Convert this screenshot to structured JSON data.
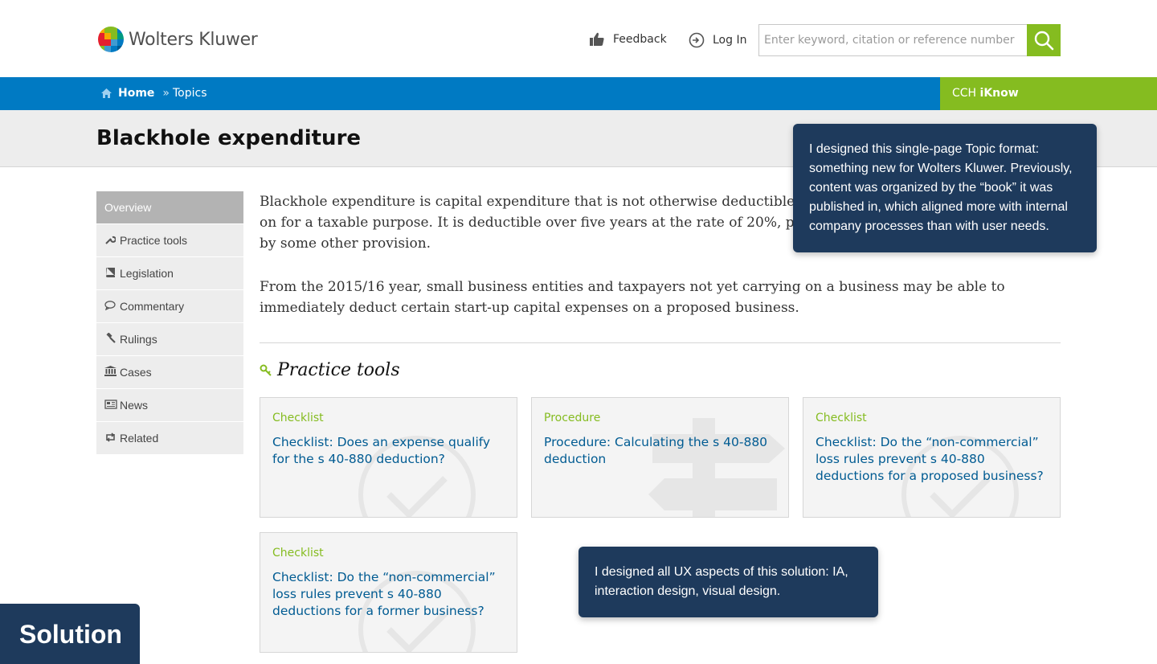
{
  "header": {
    "logo_text": "Wolters Kluwer",
    "feedback_label": "Feedback",
    "login_label": "Log In",
    "search_placeholder": "Enter keyword, citation or reference number"
  },
  "navbar": {
    "home": "Home",
    "separator": "»",
    "topics": "Topics",
    "iknow_prefix": "CCH",
    "iknow_name": "iKnow"
  },
  "page_title": "Blackhole expenditure",
  "sidebar": {
    "items": [
      {
        "label": "Overview",
        "icon": "none",
        "active": true
      },
      {
        "label": "Practice tools",
        "icon": "wrench-icon"
      },
      {
        "label": "Legislation",
        "icon": "book-icon"
      },
      {
        "label": "Commentary",
        "icon": "speech-bubble-icon"
      },
      {
        "label": "Rulings",
        "icon": "gavel-icon"
      },
      {
        "label": "Cases",
        "icon": "courthouse-icon"
      },
      {
        "label": "News",
        "icon": "newspaper-icon"
      },
      {
        "label": "Related",
        "icon": "retweet-icon"
      }
    ]
  },
  "main": {
    "para1": "Blackhole expenditure is capital expenditure that is not otherwise deductible on for a taxable purpose. It is deductible over five years at the rate of 20%, p by some other provision.",
    "para1_lines": [
      "Blackhole expenditure is capital expenditure that is not otherwise deductible",
      "on for a taxable purpose. It is deductible over five years at the rate of 20%, p",
      "by some other provision."
    ],
    "para2_lines": [
      "From the 2015/16 year, small business entities and taxpayers not yet carrying on a business may be able to",
      "immediately deduct certain start-up capital expenses on a proposed business."
    ],
    "section_title": "Practice tools"
  },
  "cards": [
    {
      "type": "Checklist",
      "title": "Checklist: Does an expense qualify for the s 40-880 deduction?",
      "watermark": "checkmark-icon"
    },
    {
      "type": "Procedure",
      "title": "Procedure: Calculating the s 40-880 deduction",
      "watermark": "signpost-icon"
    },
    {
      "type": "Checklist",
      "title": "Checklist: Do the “non-commercial” loss rules prevent s 40-880 deductions for a proposed business?",
      "watermark": "checkmark-icon"
    },
    {
      "type": "Checklist",
      "title": "Checklist: Do the “non-commercial” loss rules prevent s 40-880 deductions for a former business?",
      "watermark": "checkmark-icon"
    }
  ],
  "callouts": {
    "topic_format": "I designed this single-page Topic format: something new for Wolters Kluwer. Previously, content was organized by the “book” it was published in, which aligned more with internal company processes than with user needs.",
    "ux_aspects": "I designed all UX aspects of this solution: IA, interaction design, visual design."
  },
  "solution_label": "Solution",
  "colors": {
    "brand_blue": "#007ac3",
    "brand_green": "#85bc20",
    "link_blue": "#005b92",
    "callout_navy": "#1e3a5c"
  }
}
